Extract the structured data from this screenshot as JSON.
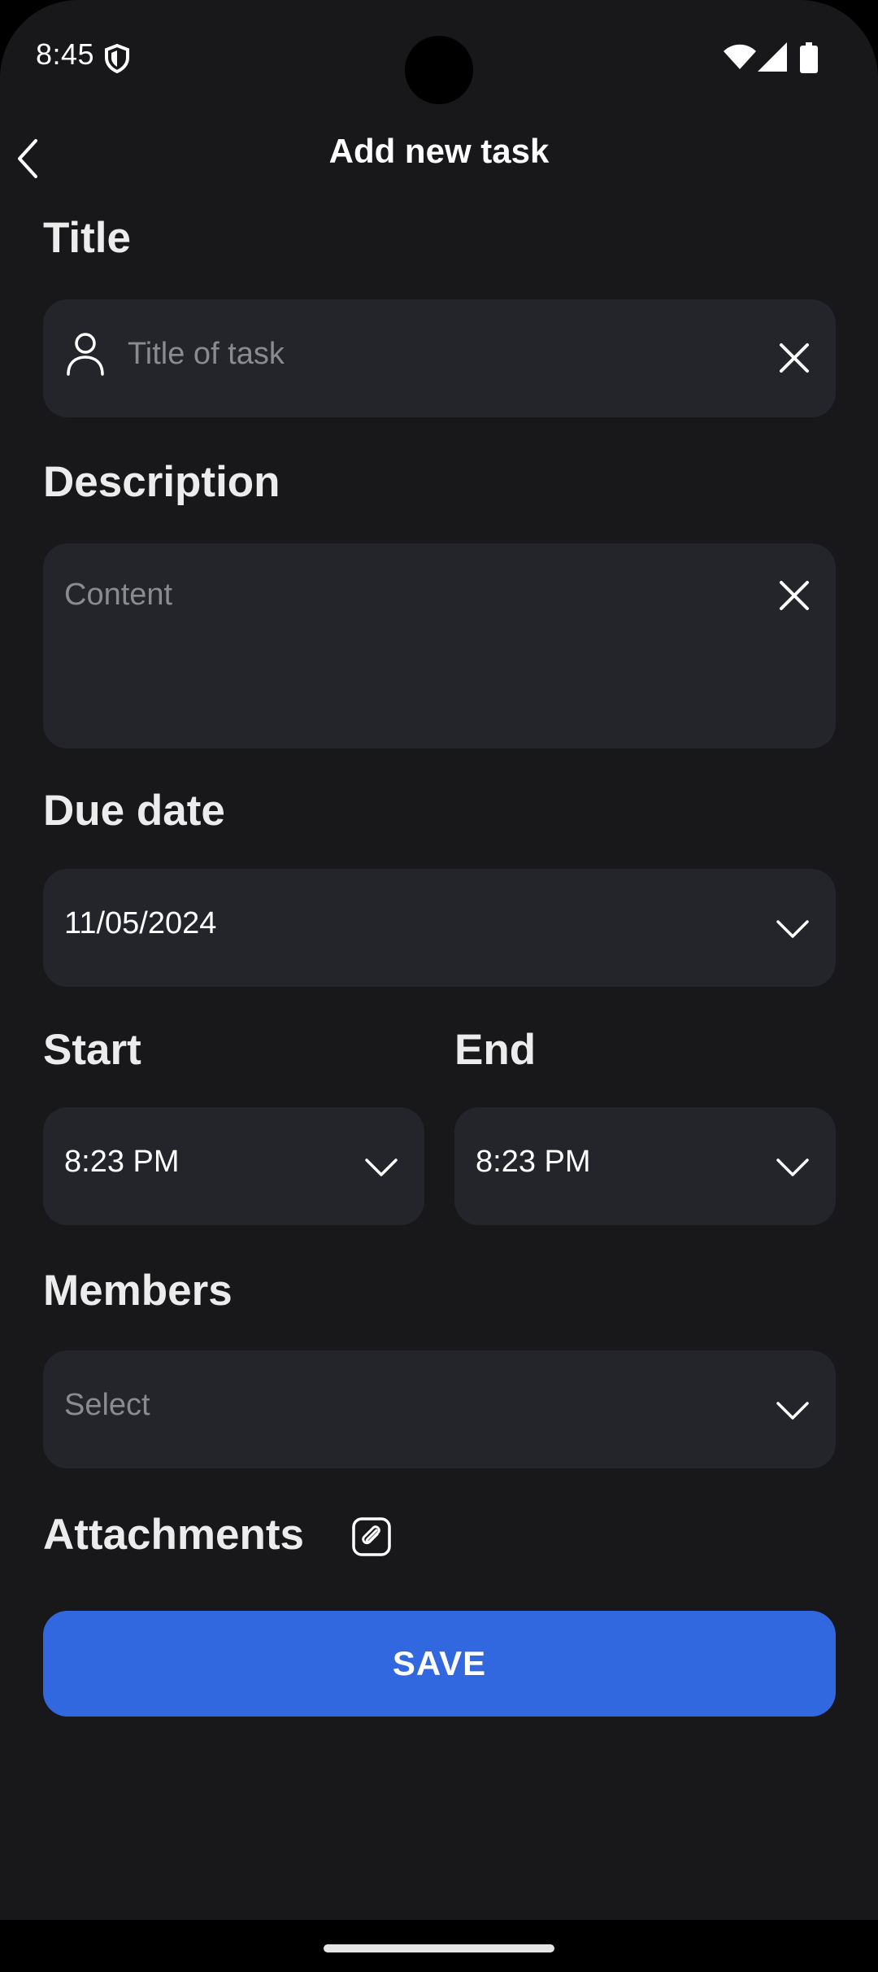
{
  "status_bar": {
    "time": "8:45",
    "icons": [
      "shield-icon",
      "wifi-icon",
      "signal-icon",
      "battery-icon"
    ]
  },
  "header": {
    "title": "Add new task",
    "back_icon": "chevron-left-icon"
  },
  "form": {
    "title_label": "Title",
    "title_placeholder": "Title of task",
    "description_label": "Description",
    "description_placeholder": "Content",
    "due_date_label": "Due date",
    "due_date_value": "11/05/2024",
    "start_label": "Start",
    "start_value": "8:23 PM",
    "end_label": "End",
    "end_value": "8:23 PM",
    "members_label": "Members",
    "members_placeholder": "Select",
    "attachments_label": "Attachments"
  },
  "actions": {
    "save_label": "SAVE"
  },
  "colors": {
    "background": "#18181b",
    "field": "#24252b",
    "accent": "#3168e0"
  }
}
